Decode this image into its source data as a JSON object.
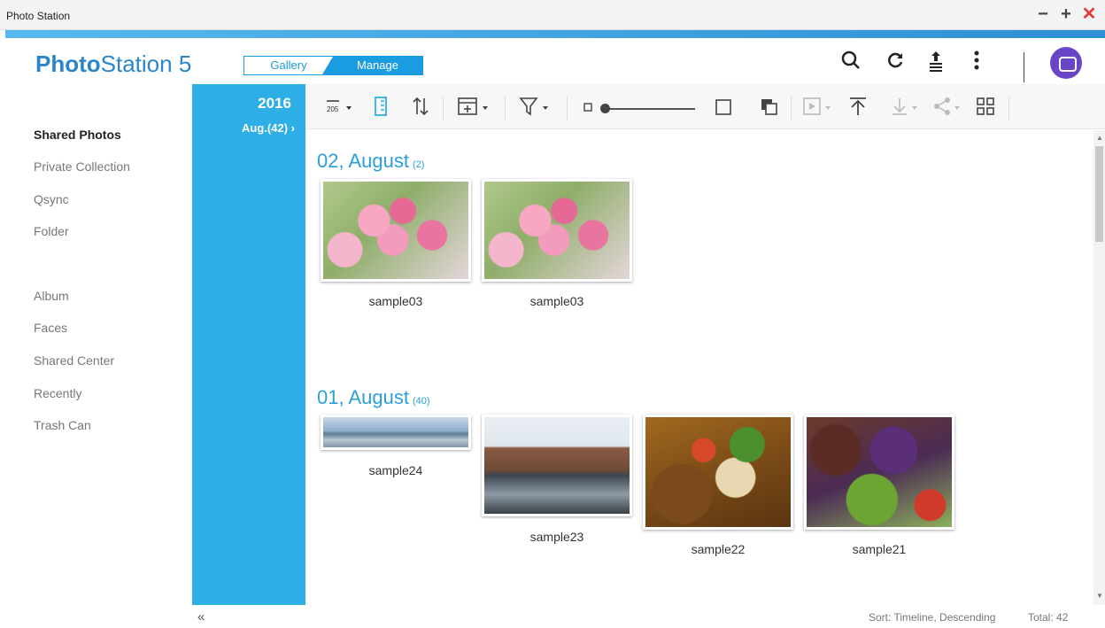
{
  "window": {
    "title": "Photo Station",
    "minimize": "−",
    "maximize": "+",
    "close": "✕"
  },
  "header": {
    "logo_bold": "Photo",
    "logo_rest": "Station 5",
    "mode": {
      "gallery": "Gallery",
      "manage": "Manage",
      "active": "Manage"
    },
    "icons": [
      "search-icon",
      "refresh-icon",
      "upload-icon",
      "more-icon",
      "user-avatar"
    ]
  },
  "sidebar": {
    "items": [
      {
        "label": "Shared Photos",
        "active": true
      },
      {
        "label": "Private Collection"
      },
      {
        "label": "Qsync"
      },
      {
        "label": "Folder"
      },
      {
        "label": "Album"
      },
      {
        "label": "Faces"
      },
      {
        "label": "Shared Center"
      },
      {
        "label": "Recently"
      },
      {
        "label": "Trash Can"
      }
    ]
  },
  "timeline": {
    "year": "2016",
    "month": "Aug.(42) ›"
  },
  "toolbar": {
    "icons": [
      "date-sort-icon",
      "list-view-icon",
      "sort-order-icon",
      "add-album-icon",
      "filter-icon",
      "small-size-icon",
      "large-size-icon",
      "select-icon",
      "copy-icon",
      "slideshow-icon",
      "upload-top-icon",
      "download-icon",
      "share-icon",
      "qr-icon"
    ],
    "zoom_level": 0.05
  },
  "sections": [
    {
      "title": "02, August",
      "count": "(2)",
      "photos": [
        {
          "name": "sample03",
          "kind": "flower"
        },
        {
          "name": "sample03",
          "kind": "flower"
        }
      ]
    },
    {
      "title": "01, August",
      "count": "(40)",
      "photos": [
        {
          "name": "sample24",
          "kind": "sky"
        },
        {
          "name": "sample23",
          "kind": "pier"
        },
        {
          "name": "sample22",
          "kind": "food1"
        },
        {
          "name": "sample21",
          "kind": "food2"
        }
      ]
    }
  ],
  "status": {
    "collapse": "«",
    "sort": "Sort: Timeline, Descending",
    "total": "Total: 42"
  },
  "colors": {
    "accent": "#2eaee6",
    "brand": "#2a86c8",
    "avatar": "#6a45c8",
    "close": "#e23b3b"
  }
}
